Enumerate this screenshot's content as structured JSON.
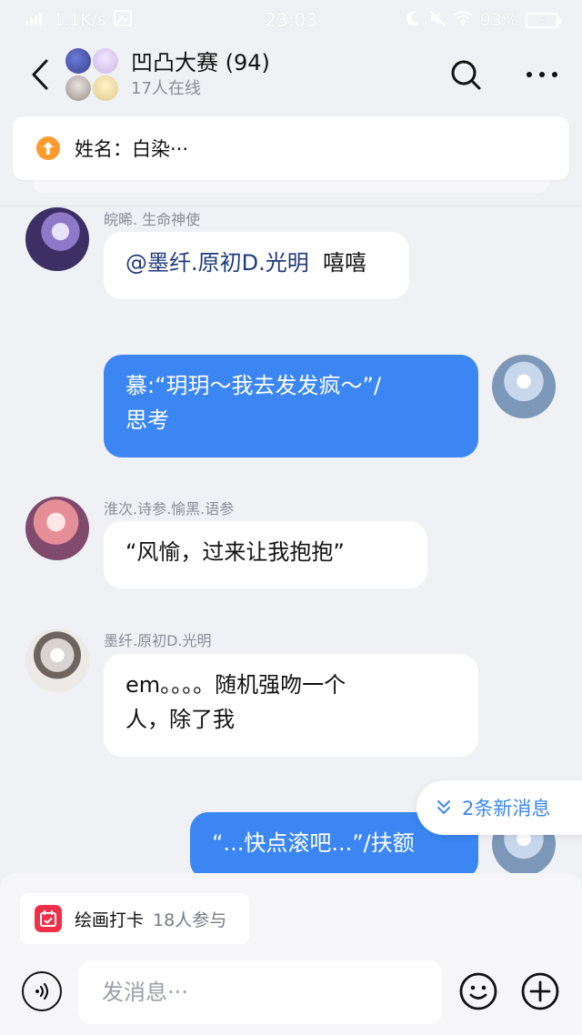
{
  "status_bar": {
    "network_speed": "1.1K/s",
    "time": "23:03",
    "battery": "93%"
  },
  "header": {
    "title": "凹凸大赛 (94)",
    "subtitle": "17人在线"
  },
  "pinned": {
    "text": "姓名：白染···"
  },
  "messages": [
    {
      "sender": "皖晞. 生命神使",
      "text_mention": "@墨纤.原初D.光明",
      "text_rest": "嘻嘻",
      "direction": "in"
    },
    {
      "sender": "",
      "line1": "慕:“玥玥～我去发发疯～”/",
      "line2": "思考",
      "direction": "out"
    },
    {
      "sender": "淮次.诗参.愉黑.语参",
      "text": "“风愉，过来让我抱抱”",
      "direction": "in"
    },
    {
      "sender": "墨纤.原初D.光明",
      "line1": "em。。。。随机强吻一个",
      "line2": "人，除了我",
      "direction": "in"
    },
    {
      "sender": "",
      "text": "“...快点滚吧...”/扶额",
      "direction": "out"
    }
  ],
  "new_messages": "2条新消息",
  "activity_chip": {
    "title": "绘画打卡",
    "count": "18人参与"
  },
  "composer": {
    "placeholder": "发消息···"
  },
  "colors": {
    "accent": "#3b86f2",
    "background": "#f0f1f5",
    "pin_icon": "#ff9a2e",
    "activity_icon": "#f2304a"
  }
}
